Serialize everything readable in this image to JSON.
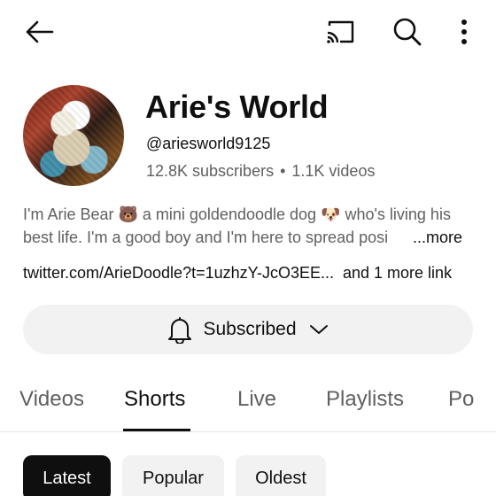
{
  "topbar": {
    "icons": [
      "back-arrow-icon",
      "cast-icon",
      "search-icon",
      "more-vert-icon"
    ]
  },
  "channel": {
    "name": "Arie's World",
    "handle": "@ariesworld9125",
    "subscribers": "12.8K subscribers",
    "separator": "•",
    "videos": "1.1K videos"
  },
  "description": {
    "line1": "I'm Arie Bear 🐻 a mini goldendoodle dog 🐶 who's living his",
    "line2": "best life. I'm a good boy and I'm here to spread posi",
    "more_label": "...more"
  },
  "links": {
    "primary": "twitter.com/ArieDoodle?t=1uzhzY-JcO3EE...",
    "extra": "and 1 more link"
  },
  "subscribe": {
    "label": "Subscribed",
    "icons": [
      "bell-icon",
      "chevron-down-icon"
    ]
  },
  "tabs": [
    {
      "label": "Videos"
    },
    {
      "label": "Shorts",
      "active": true
    },
    {
      "label": "Live"
    },
    {
      "label": "Playlists"
    },
    {
      "label": "Po"
    }
  ],
  "chips": [
    {
      "label": "Latest",
      "active": true
    },
    {
      "label": "Popular"
    },
    {
      "label": "Oldest"
    }
  ]
}
